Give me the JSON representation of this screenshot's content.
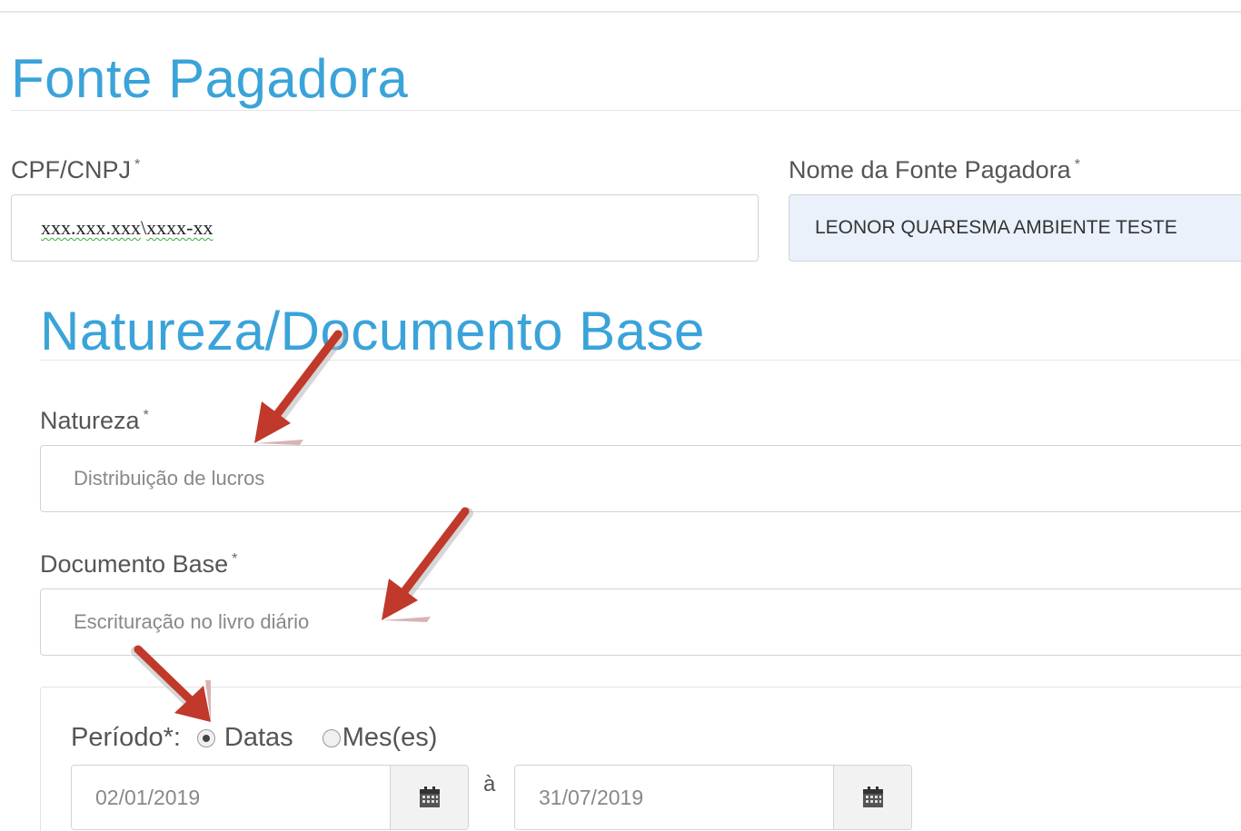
{
  "fonte_pagadora": {
    "title": "Fonte Pagadora",
    "cpf_label": "CPF/CNPJ",
    "cpf_part1": "xxx.xxx.xxx",
    "cpf_sep": "\\",
    "cpf_part2": "xxxx-xx",
    "nome_label": "Nome da Fonte Pagadora",
    "nome_value": "LEONOR QUARESMA AMBIENTE TESTE",
    "required_mark": "*"
  },
  "natureza_documento": {
    "title": "Natureza/Documento Base",
    "natureza_label": "Natureza",
    "natureza_value": "Distribuição de lucros",
    "documento_label": "Documento Base",
    "documento_value": "Escrituração no livro diário",
    "required_mark": "*"
  },
  "periodo": {
    "label": "Período*:",
    "option_datas": "Datas",
    "option_meses": "Mes(es)",
    "selected": "Datas",
    "date_from": "02/01/2019",
    "separator": "à",
    "date_to": "31/07/2019"
  },
  "icons": {
    "calendar": "calendar-icon",
    "annotation_arrow": "red-arrow-icon"
  },
  "colors": {
    "title_blue": "#3aa3d9",
    "readonly_bg": "#eaf1fb",
    "arrow_red": "#c0392b"
  }
}
